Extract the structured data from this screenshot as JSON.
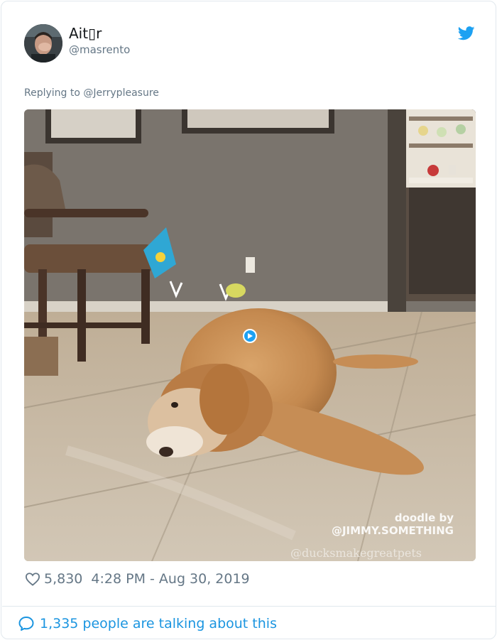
{
  "tweet": {
    "author": {
      "display_name": "Ait▯r",
      "handle": "@masrento",
      "avatar_icon": "user-avatar"
    },
    "platform_icon": "twitter-bird-icon",
    "reply": {
      "prefix": "Replying to ",
      "mention": "@Jerrypleasure"
    },
    "media": {
      "type": "video-gif",
      "watermark_line1": "doodle by",
      "watermark_line2": "@JIMMY.SOMETHING",
      "watermark_line3": "@ducksmakegreatpets"
    },
    "likes": "5,830",
    "timestamp": "4:28 PM - Aug 30, 2019",
    "conversation": "1,335 people are talking about this"
  },
  "colors": {
    "accent": "#1da1f2",
    "link": "#1b95e0",
    "muted": "#657786",
    "text": "#14171a",
    "border": "#e1e8ed"
  }
}
